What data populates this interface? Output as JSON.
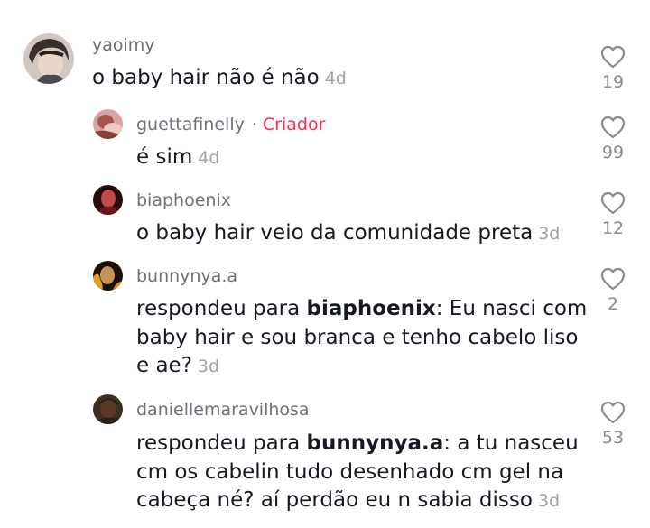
{
  "comments": [
    {
      "username": "yaoimy",
      "text": "o baby hair não é não",
      "time": "4d",
      "likes": "19",
      "avatar_icon": "avatar-illustrated-man"
    },
    {
      "username": "guettafinelly",
      "creator_label": "Criador",
      "text": "é sim",
      "time": "4d",
      "likes": "99",
      "avatar_icon": "avatar-photo-pink"
    },
    {
      "username": "biaphoenix",
      "text": "o baby hair veio da comunidade preta",
      "time": "3d",
      "likes": "12",
      "avatar_icon": "avatar-photo-red"
    },
    {
      "username": "bunnynya.a",
      "reply_prefix": "respondeu para",
      "mention": "biaphoenix",
      "text": ": Eu nasci com baby hair e sou branca e tenho cabelo liso e ae?",
      "time": "3d",
      "likes": "2",
      "avatar_icon": "avatar-photo-dark-fire"
    },
    {
      "username": "daniellemaravilhosa",
      "reply_prefix": "respondeu para",
      "mention": "bunnynya.a",
      "text": ": a tu nasceu cm os cabelin tudo desenhado cm gel na cabeça né? aí perdão eu n sabia disso",
      "time": "3d",
      "likes": "53",
      "avatar_icon": "avatar-photo-dark"
    }
  ],
  "colors": {
    "creator_badge": "#fe2c55",
    "username": "#6f7078",
    "text": "#161823",
    "timestamp": "#a0a1a7"
  }
}
